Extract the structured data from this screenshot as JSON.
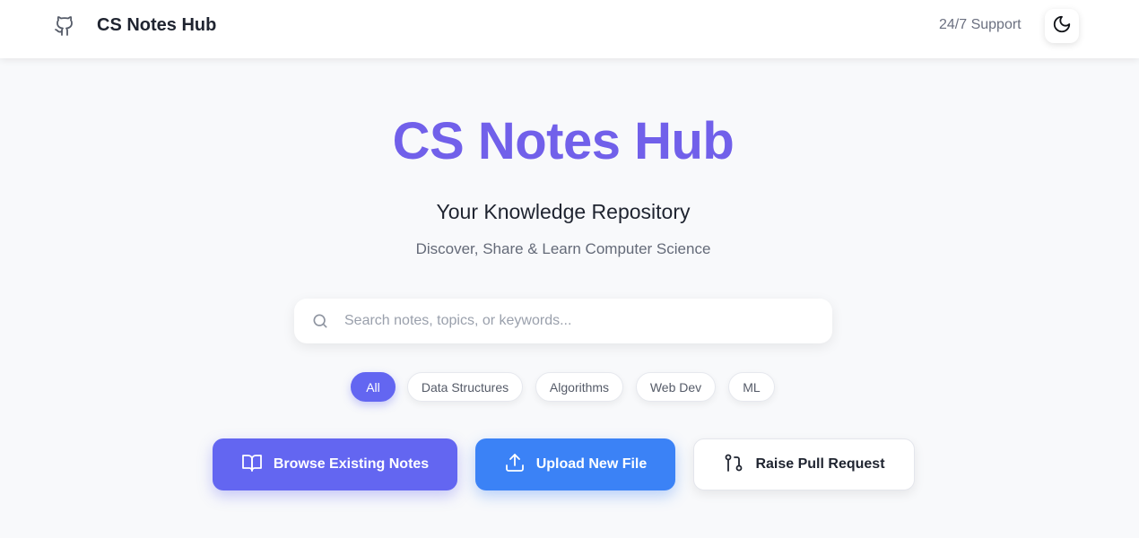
{
  "header": {
    "brand_icon": "github-icon",
    "brand_name": "CS Notes Hub",
    "support_label": "24/7 Support",
    "theme_toggle_icon": "moon-icon"
  },
  "hero": {
    "title": "CS Notes Hub",
    "subtitle": "Your Knowledge Repository",
    "description": "Discover, Share & Learn Computer Science"
  },
  "search": {
    "icon": "search-icon",
    "placeholder": "Search notes, topics, or keywords...",
    "value": ""
  },
  "filters": [
    {
      "label": "All",
      "active": true
    },
    {
      "label": "Data Structures",
      "active": false
    },
    {
      "label": "Algorithms",
      "active": false
    },
    {
      "label": "Web Dev",
      "active": false
    },
    {
      "label": "ML",
      "active": false
    }
  ],
  "actions": {
    "browse": {
      "label": "Browse Existing Notes",
      "icon": "book-open-icon"
    },
    "upload": {
      "label": "Upload New File",
      "icon": "upload-icon"
    },
    "pull_request": {
      "label": "Raise Pull Request",
      "icon": "git-pull-request-icon"
    }
  },
  "colors": {
    "accent": "#6366f1",
    "title": "#7160ea",
    "upload": "#3b82f6"
  }
}
